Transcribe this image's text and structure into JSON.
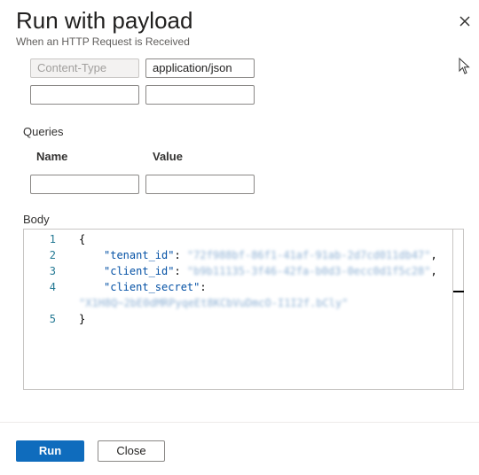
{
  "dialog": {
    "title": "Run with payload",
    "subtitle": "When an HTTP Request is Received"
  },
  "headers": {
    "rows": [
      {
        "key": "Content-Type",
        "value": "application/json"
      },
      {
        "key": "",
        "value": ""
      }
    ]
  },
  "queries": {
    "label": "Queries",
    "name_header": "Name",
    "value_header": "Value",
    "rows": [
      {
        "name": "",
        "value": ""
      }
    ]
  },
  "body": {
    "label": "Body",
    "line_numbers": [
      "1",
      "2",
      "3",
      "4",
      "5"
    ],
    "open_brace": "{",
    "close_brace": "}",
    "tenant_key": "\"tenant_id\"",
    "client_id_key": "\"client_id\"",
    "client_secret_key": "\"client_secret\"",
    "colon": ":",
    "comma": ",",
    "tenant_value": "\"72f988bf-86f1-41af-91ab-2d7cd011db47\"",
    "client_id_value": "\"b9b11135-3f46-42fa-b0d3-0ecc0d1f5c28\"",
    "client_secret_value": "\"X1H8Q~2bE0dMRPyqeEt8KCbVuDmcO-I1I2f.bCly\""
  },
  "buttons": {
    "run": "Run",
    "close": "Close"
  },
  "icons": {
    "close": "close-icon",
    "cursor": "mouse-pointer-icon"
  }
}
